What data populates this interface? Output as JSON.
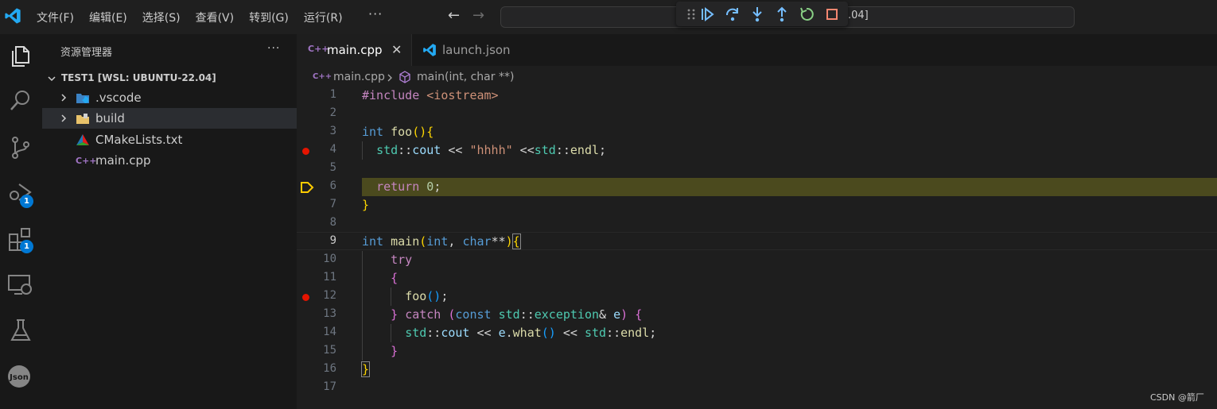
{
  "titlebar": {
    "menu": [
      "文件(F)",
      "编辑(E)",
      "选择(S)",
      "查看(V)",
      "转到(G)",
      "运行(R)"
    ],
    "more": "···",
    "command_center_text": ".04]"
  },
  "debug_toolbar": {
    "icons": [
      "gripper-icon",
      "continue-icon",
      "step-over-icon",
      "step-into-icon",
      "step-out-icon",
      "restart-icon",
      "stop-icon"
    ]
  },
  "activity_bar": {
    "items": [
      "explorer-icon",
      "search-icon",
      "source-control-icon",
      "run-debug-icon",
      "extensions-icon",
      "remote-explorer-icon",
      "testing-icon",
      "json-icon"
    ],
    "debug_badge": "1",
    "extensions_badge": "1"
  },
  "sidebar": {
    "title": "资源管理器",
    "more": "···",
    "root": "TEST1 [WSL: UBUNTU-22.04]",
    "items": [
      {
        "label": ".vscode",
        "type": "folder"
      },
      {
        "label": "build",
        "type": "folder"
      },
      {
        "label": "CMakeLists.txt",
        "type": "file"
      },
      {
        "label": "main.cpp",
        "type": "file"
      }
    ]
  },
  "tabs": [
    {
      "label": "main.cpp",
      "icon": "C++",
      "active": true,
      "close": "✕"
    },
    {
      "label": "launch.json",
      "icon": "vscode-icon",
      "active": false
    }
  ],
  "breadcrumb": {
    "file": "main.cpp",
    "symbol": "main(int, char **)"
  },
  "editor": {
    "line_numbers": [
      "1",
      "2",
      "3",
      "4",
      "5",
      "6",
      "7",
      "8",
      "9",
      "10",
      "11",
      "12",
      "13",
      "14",
      "15",
      "16",
      "17"
    ],
    "breakpoint_lines": [
      4,
      12
    ],
    "current_line": 6,
    "cursor_line": 9
  },
  "colors": {
    "accent": "#0078d4",
    "breakpoint": "#e51400",
    "current_line_bg": "#4b4a1e",
    "debug_arrow": "#ffcc00"
  },
  "watermark": "CSDN @箭厂"
}
